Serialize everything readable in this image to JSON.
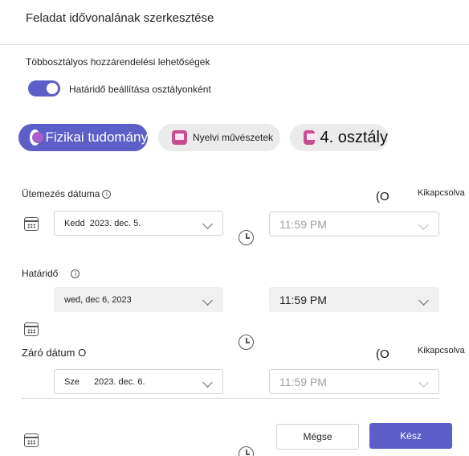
{
  "dialog": {
    "title": "Feladat idővonalának szerkesztése"
  },
  "multiclass": {
    "section_label": "Többosztályos hozzárendelési lehetőségek",
    "toggle_label": "Határidő beállítása osztályonként",
    "toggle_on": true
  },
  "tabs": [
    {
      "label": "Fizikai tudomány",
      "active": true
    },
    {
      "label": "Nyelvi művészetek",
      "active": false
    },
    {
      "label": "4. osztály",
      "active": false
    }
  ],
  "schedule": {
    "label": "Ütemezés dátuma",
    "mark": "(O",
    "off_label": "Kikapcsolva",
    "date_day": "Kedd",
    "date_value": "2023. dec. 5.",
    "time": "11:59 PM"
  },
  "due": {
    "label": "Határidő",
    "date_value": "wed, dec 6, 2023",
    "time": "11:59 PM"
  },
  "close": {
    "label": "Záró dátum O",
    "mark": "(O",
    "off_label": "Kikapcsolva",
    "date_day": "Sze",
    "date_value": "2023. dec. 6.",
    "time": "11:59 PM"
  },
  "buttons": {
    "cancel": "Mégse",
    "done": "Kész"
  },
  "colors": {
    "accent": "#5b5fc7",
    "tab_inactive": "#ebebeb",
    "book_icon": "#c94c8e"
  }
}
